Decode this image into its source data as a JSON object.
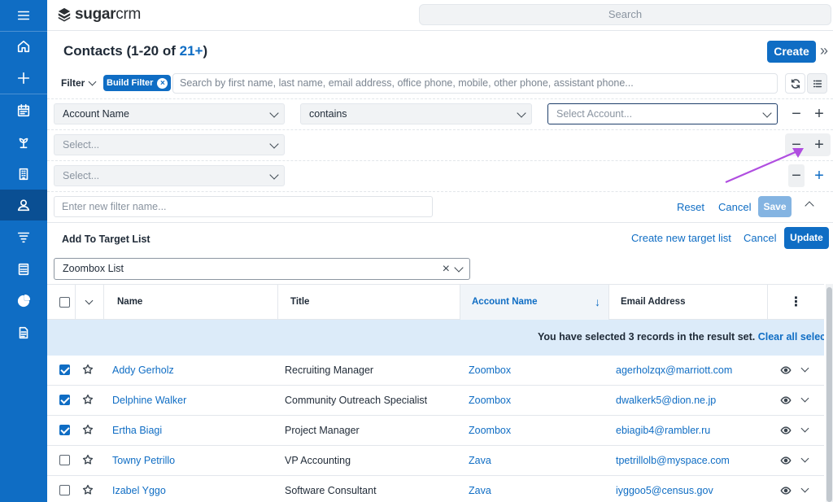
{
  "app": {
    "logo_text_bold": "sugar",
    "logo_text_light": "crm",
    "search_placeholder": "Search"
  },
  "header": {
    "title": "Contacts (1-20 of ",
    "count": "21+",
    "title_end": ")",
    "create_label": "Create"
  },
  "filter": {
    "label": "Filter",
    "chip_label": "Build Filter",
    "search_placeholder": "Search by first name, last name, email address, office phone, mobile, other phone, assistant phone..."
  },
  "builder": {
    "row1": {
      "field": "Account Name",
      "operator": "contains",
      "value_placeholder": "Select Account..."
    },
    "row2": {
      "field_placeholder": "Select..."
    },
    "row3": {
      "field_placeholder": "Select..."
    },
    "minus": "−",
    "plus": "+",
    "new_filter_placeholder": "Enter new filter name...",
    "reset": "Reset",
    "cancel": "Cancel",
    "save": "Save"
  },
  "target_list": {
    "title": "Add To Target List",
    "create_new": "Create new target list",
    "cancel": "Cancel",
    "update": "Update",
    "selected": "Zoombox List"
  },
  "table": {
    "columns": [
      "Name",
      "Title",
      "Account Name",
      "Email Address"
    ],
    "banner_text": "You have selected 3 records in the result set. ",
    "banner_link": "Clear all selections",
    "rows": [
      {
        "name": "Addy Gerholz",
        "title": "Recruiting Manager",
        "account": "Zoombox",
        "email": "agerholzqx@marriott.com",
        "checked": true
      },
      {
        "name": "Delphine Walker",
        "title": "Community Outreach Specialist",
        "account": "Zoombox",
        "email": "dwalkerk5@dion.ne.jp",
        "checked": true
      },
      {
        "name": "Ertha Biagi",
        "title": "Project Manager",
        "account": "Zoombox",
        "email": "ebiagib4@rambler.ru",
        "checked": true
      },
      {
        "name": "Towny Petrillo",
        "title": "VP Accounting",
        "account": "Zava",
        "email": "tpetrillolb@myspace.com",
        "checked": false
      },
      {
        "name": "Izabel Yggo",
        "title": "Software Consultant",
        "account": "Zava",
        "email": "iyggoo5@census.gov",
        "checked": false
      }
    ]
  },
  "colors": {
    "primary": "#0f6dc4",
    "rail": "#0f6dc4",
    "banner": "#dcebf9",
    "annotation_arrow": "#b04ee0"
  }
}
